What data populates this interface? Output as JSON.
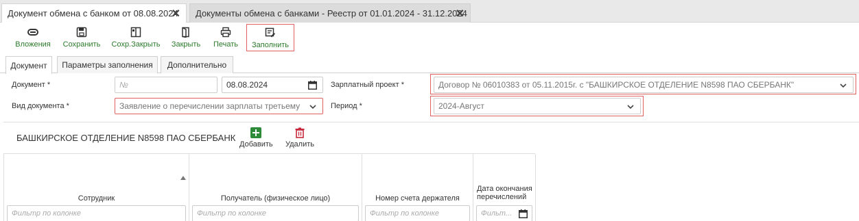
{
  "tabs": [
    {
      "label": "Документ обмена с банком от 08.08.2024"
    },
    {
      "label": "Документы обмена с банками - Реестр от 01.01.2024 - 31.12.2024"
    }
  ],
  "toolbar": {
    "attachments": "Вложения",
    "save": "Сохранить",
    "save_close": "Сохр.Закрыть",
    "close": "Закрыть",
    "print": "Печать",
    "fill": "Заполнить"
  },
  "sub_tabs": [
    "Документ",
    "Параметры заполнения",
    "Дополнительно"
  ],
  "form": {
    "document_label": "Документ *",
    "document_number_placeholder": "№",
    "document_date": "08.08.2024",
    "salary_project_label": "Зарплатный проект *",
    "salary_project_value": "Договор № 06010383 от 05.11.2015г. с \"БАШКИРСКОЕ ОТДЕЛЕНИЕ N8598 ПАО СБЕРБАНК\"",
    "doc_type_label": "Вид документа *",
    "doc_type_value": "Заявление о перечислении зарплаты третьему",
    "period_label": "Период *",
    "period_value": "2024-Август"
  },
  "panel": {
    "title": "БАШКИРСКОЕ ОТДЕЛЕНИЕ N8598 ПАО СБЕРБАНК",
    "add": "Добавить",
    "delete": "Удалить"
  },
  "grid": {
    "columns": [
      "Сотрудник",
      "Получатель (физическое лицо)",
      "Номер счета держателя",
      "Дата окончания перечислений"
    ],
    "filter_placeholder": "Фильтр по колонке",
    "filter_short": "Фильт..."
  },
  "colors": {
    "accent_green": "#2b7a2b",
    "highlight_red": "#e06060",
    "delete_red": "#c8283c"
  }
}
